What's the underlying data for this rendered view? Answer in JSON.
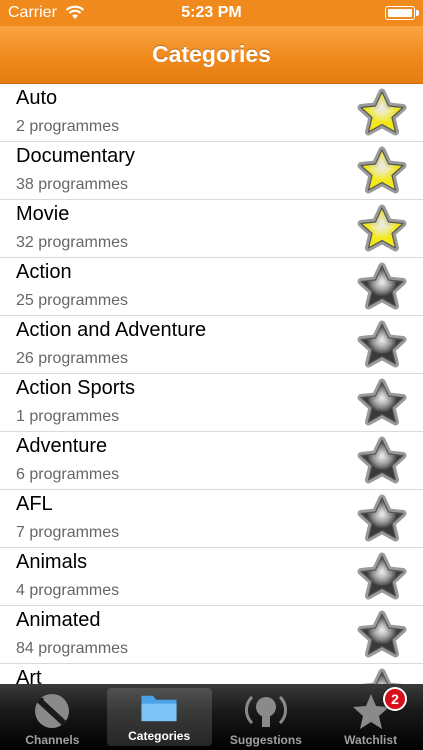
{
  "status": {
    "carrier": "Carrier",
    "time": "5:23 PM"
  },
  "nav": {
    "title": "Categories"
  },
  "categories": [
    {
      "name": "Auto",
      "count": "2 programmes",
      "starred": true
    },
    {
      "name": "Documentary",
      "count": "38 programmes",
      "starred": true
    },
    {
      "name": "Movie",
      "count": "32 programmes",
      "starred": true
    },
    {
      "name": "Action",
      "count": "25 programmes",
      "starred": false
    },
    {
      "name": "Action and Adventure",
      "count": "26 programmes",
      "starred": false
    },
    {
      "name": "Action Sports",
      "count": "1 programmes",
      "starred": false
    },
    {
      "name": "Adventure",
      "count": "6 programmes",
      "starred": false
    },
    {
      "name": "AFL",
      "count": "7 programmes",
      "starred": false
    },
    {
      "name": "Animals",
      "count": "4 programmes",
      "starred": false
    },
    {
      "name": "Animated",
      "count": "84 programmes",
      "starred": false
    },
    {
      "name": "Art",
      "count": "",
      "starred": false
    }
  ],
  "tabs": {
    "channels": "Channels",
    "categories": "Categories",
    "suggestions": "Suggestions",
    "watchlist": "Watchlist",
    "watchlist_badge": "2"
  },
  "colors": {
    "accent": "#f08a1d",
    "star_on": "#f2e81a",
    "star_off": "#3a3a3a"
  }
}
